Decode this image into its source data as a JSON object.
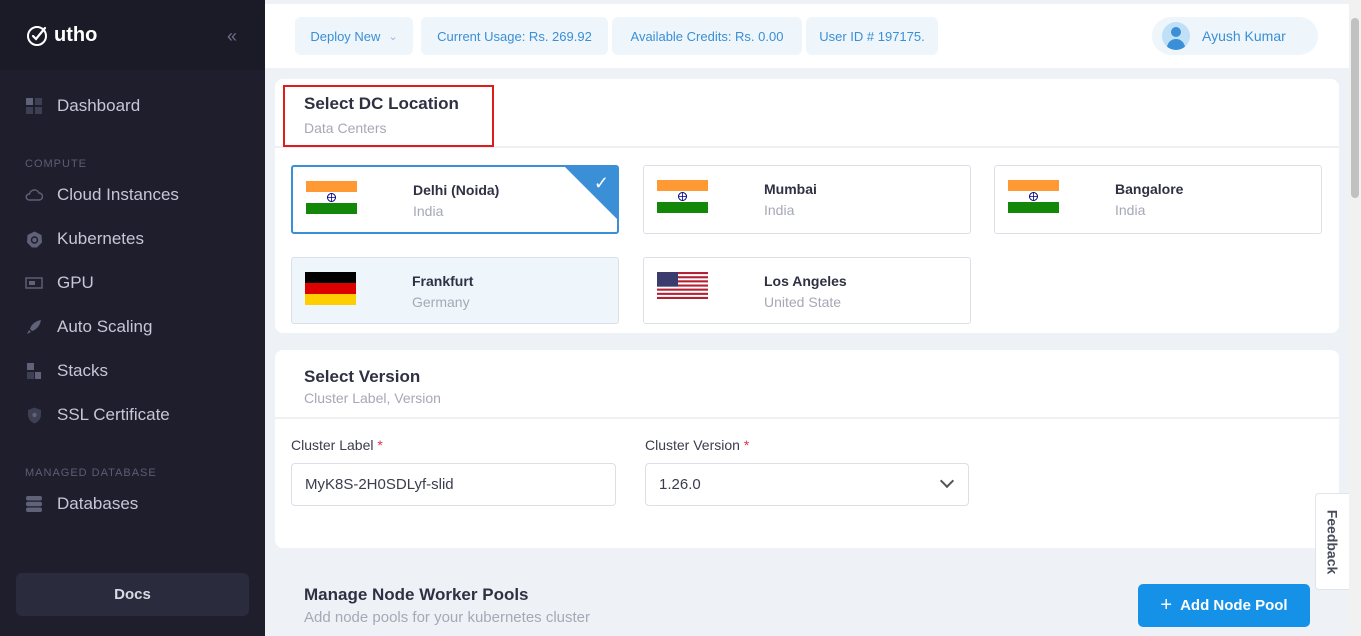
{
  "brand": {
    "name": "utho"
  },
  "sidebar": {
    "items": [
      {
        "label": "Dashboard",
        "icon": "dashboard-icon"
      },
      {
        "label": "Cloud Instances",
        "icon": "cloud-icon"
      },
      {
        "label": "Kubernetes",
        "icon": "kubernetes-icon"
      },
      {
        "label": "GPU",
        "icon": "gpu-icon"
      },
      {
        "label": "Auto Scaling",
        "icon": "rocket-icon"
      },
      {
        "label": "Stacks",
        "icon": "stacks-icon"
      },
      {
        "label": "SSL Certificate",
        "icon": "shield-icon"
      },
      {
        "label": "Databases",
        "icon": "database-icon"
      }
    ],
    "sections": {
      "compute": "COMPUTE",
      "managed_database": "MANAGED DATABASE"
    },
    "docs_label": "Docs"
  },
  "header": {
    "deploy_new": "Deploy New",
    "current_usage": "Current Usage: Rs. 269.92",
    "available_credits": "Available Credits: Rs. 0.00",
    "user_id": "User ID # 197175.",
    "user_name": "Ayush Kumar"
  },
  "dc_section": {
    "title": "Select DC Location",
    "subtitle": "Data Centers",
    "locations": [
      {
        "city": "Delhi (Noida)",
        "country": "India",
        "flag": "india",
        "selected": true
      },
      {
        "city": "Mumbai",
        "country": "India",
        "flag": "india",
        "selected": false
      },
      {
        "city": "Bangalore",
        "country": "India",
        "flag": "india",
        "selected": false
      },
      {
        "city": "Frankfurt",
        "country": "Germany",
        "flag": "germany",
        "selected": false
      },
      {
        "city": "Los Angeles",
        "country": "United State",
        "flag": "usa",
        "selected": false
      }
    ]
  },
  "version_section": {
    "title": "Select Version",
    "subtitle": "Cluster Label, Version",
    "cluster_label": {
      "label": "Cluster Label",
      "required_mark": "*",
      "value": "MyK8S-2H0SDLyf-slid"
    },
    "cluster_version": {
      "label": "Cluster Version",
      "required_mark": "*",
      "value": "1.26.0"
    }
  },
  "node_pools": {
    "title": "Manage Node Worker Pools",
    "subtitle": "Add node pools for your kubernetes cluster",
    "add_button": "Add Node Pool"
  },
  "feedback_label": "Feedback",
  "colors": {
    "accent": "#1691e8",
    "sidebar_bg": "#1e1e2d",
    "highlight": "#e01b1b"
  }
}
